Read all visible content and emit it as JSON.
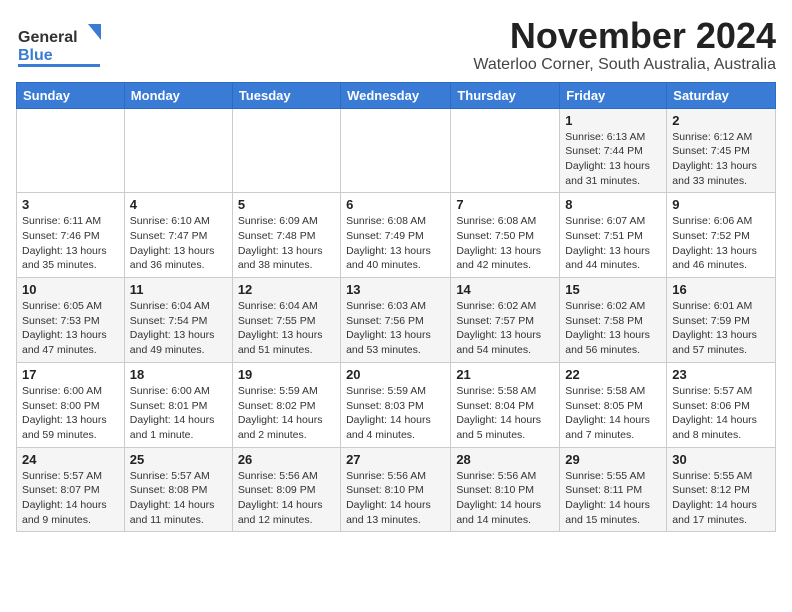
{
  "header": {
    "logo_line1": "General",
    "logo_line2": "Blue",
    "title": "November 2024",
    "subtitle": "Waterloo Corner, South Australia, Australia"
  },
  "weekdays": [
    "Sunday",
    "Monday",
    "Tuesday",
    "Wednesday",
    "Thursday",
    "Friday",
    "Saturday"
  ],
  "weeks": [
    [
      {
        "day": "",
        "info": ""
      },
      {
        "day": "",
        "info": ""
      },
      {
        "day": "",
        "info": ""
      },
      {
        "day": "",
        "info": ""
      },
      {
        "day": "",
        "info": ""
      },
      {
        "day": "1",
        "info": "Sunrise: 6:13 AM\nSunset: 7:44 PM\nDaylight: 13 hours\nand 31 minutes."
      },
      {
        "day": "2",
        "info": "Sunrise: 6:12 AM\nSunset: 7:45 PM\nDaylight: 13 hours\nand 33 minutes."
      }
    ],
    [
      {
        "day": "3",
        "info": "Sunrise: 6:11 AM\nSunset: 7:46 PM\nDaylight: 13 hours\nand 35 minutes."
      },
      {
        "day": "4",
        "info": "Sunrise: 6:10 AM\nSunset: 7:47 PM\nDaylight: 13 hours\nand 36 minutes."
      },
      {
        "day": "5",
        "info": "Sunrise: 6:09 AM\nSunset: 7:48 PM\nDaylight: 13 hours\nand 38 minutes."
      },
      {
        "day": "6",
        "info": "Sunrise: 6:08 AM\nSunset: 7:49 PM\nDaylight: 13 hours\nand 40 minutes."
      },
      {
        "day": "7",
        "info": "Sunrise: 6:08 AM\nSunset: 7:50 PM\nDaylight: 13 hours\nand 42 minutes."
      },
      {
        "day": "8",
        "info": "Sunrise: 6:07 AM\nSunset: 7:51 PM\nDaylight: 13 hours\nand 44 minutes."
      },
      {
        "day": "9",
        "info": "Sunrise: 6:06 AM\nSunset: 7:52 PM\nDaylight: 13 hours\nand 46 minutes."
      }
    ],
    [
      {
        "day": "10",
        "info": "Sunrise: 6:05 AM\nSunset: 7:53 PM\nDaylight: 13 hours\nand 47 minutes."
      },
      {
        "day": "11",
        "info": "Sunrise: 6:04 AM\nSunset: 7:54 PM\nDaylight: 13 hours\nand 49 minutes."
      },
      {
        "day": "12",
        "info": "Sunrise: 6:04 AM\nSunset: 7:55 PM\nDaylight: 13 hours\nand 51 minutes."
      },
      {
        "day": "13",
        "info": "Sunrise: 6:03 AM\nSunset: 7:56 PM\nDaylight: 13 hours\nand 53 minutes."
      },
      {
        "day": "14",
        "info": "Sunrise: 6:02 AM\nSunset: 7:57 PM\nDaylight: 13 hours\nand 54 minutes."
      },
      {
        "day": "15",
        "info": "Sunrise: 6:02 AM\nSunset: 7:58 PM\nDaylight: 13 hours\nand 56 minutes."
      },
      {
        "day": "16",
        "info": "Sunrise: 6:01 AM\nSunset: 7:59 PM\nDaylight: 13 hours\nand 57 minutes."
      }
    ],
    [
      {
        "day": "17",
        "info": "Sunrise: 6:00 AM\nSunset: 8:00 PM\nDaylight: 13 hours\nand 59 minutes."
      },
      {
        "day": "18",
        "info": "Sunrise: 6:00 AM\nSunset: 8:01 PM\nDaylight: 14 hours\nand 1 minute."
      },
      {
        "day": "19",
        "info": "Sunrise: 5:59 AM\nSunset: 8:02 PM\nDaylight: 14 hours\nand 2 minutes."
      },
      {
        "day": "20",
        "info": "Sunrise: 5:59 AM\nSunset: 8:03 PM\nDaylight: 14 hours\nand 4 minutes."
      },
      {
        "day": "21",
        "info": "Sunrise: 5:58 AM\nSunset: 8:04 PM\nDaylight: 14 hours\nand 5 minutes."
      },
      {
        "day": "22",
        "info": "Sunrise: 5:58 AM\nSunset: 8:05 PM\nDaylight: 14 hours\nand 7 minutes."
      },
      {
        "day": "23",
        "info": "Sunrise: 5:57 AM\nSunset: 8:06 PM\nDaylight: 14 hours\nand 8 minutes."
      }
    ],
    [
      {
        "day": "24",
        "info": "Sunrise: 5:57 AM\nSunset: 8:07 PM\nDaylight: 14 hours\nand 9 minutes."
      },
      {
        "day": "25",
        "info": "Sunrise: 5:57 AM\nSunset: 8:08 PM\nDaylight: 14 hours\nand 11 minutes."
      },
      {
        "day": "26",
        "info": "Sunrise: 5:56 AM\nSunset: 8:09 PM\nDaylight: 14 hours\nand 12 minutes."
      },
      {
        "day": "27",
        "info": "Sunrise: 5:56 AM\nSunset: 8:10 PM\nDaylight: 14 hours\nand 13 minutes."
      },
      {
        "day": "28",
        "info": "Sunrise: 5:56 AM\nSunset: 8:10 PM\nDaylight: 14 hours\nand 14 minutes."
      },
      {
        "day": "29",
        "info": "Sunrise: 5:55 AM\nSunset: 8:11 PM\nDaylight: 14 hours\nand 15 minutes."
      },
      {
        "day": "30",
        "info": "Sunrise: 5:55 AM\nSunset: 8:12 PM\nDaylight: 14 hours\nand 17 minutes."
      }
    ]
  ]
}
